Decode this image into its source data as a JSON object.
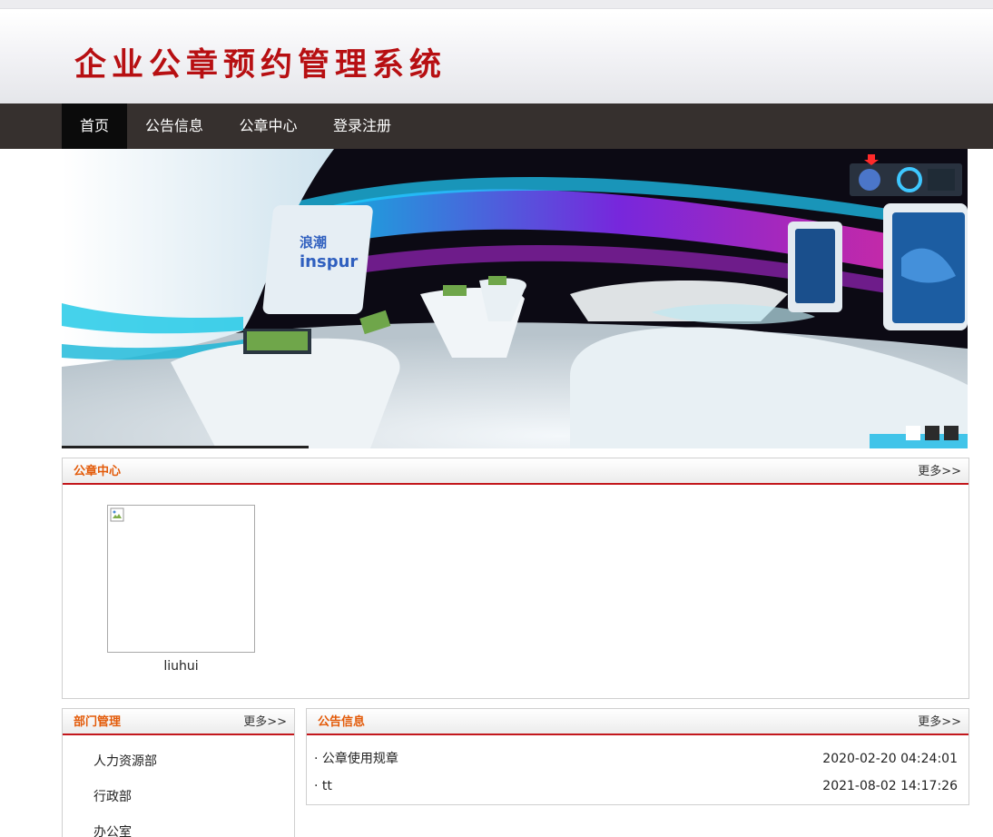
{
  "header": {
    "title": "企业公章预约管理系统"
  },
  "nav": {
    "items": [
      {
        "label": "首页",
        "active": true
      },
      {
        "label": "公告信息",
        "active": false
      },
      {
        "label": "公章中心",
        "active": false
      },
      {
        "label": "登录注册",
        "active": false
      }
    ]
  },
  "banner": {
    "slide_count": 3,
    "active_slide": 1
  },
  "seal_center": {
    "title": "公章中心",
    "more": "更多>>",
    "items": [
      {
        "name": "liuhui"
      }
    ]
  },
  "departments": {
    "title": "部门管理",
    "more": "更多>>",
    "items": [
      {
        "label": "人力资源部"
      },
      {
        "label": "行政部"
      },
      {
        "label": "办公室"
      }
    ]
  },
  "notices": {
    "title": "公告信息",
    "more": "更多>>",
    "items": [
      {
        "title": "· 公章使用规章",
        "date": "2020-02-20 04:24:01"
      },
      {
        "title": "· tt",
        "date": "2021-08-02 14:17:26"
      }
    ]
  },
  "colors": {
    "brand_red": "#b70f12",
    "nav_bg": "#36302e",
    "accent_orange": "#e35a08"
  }
}
